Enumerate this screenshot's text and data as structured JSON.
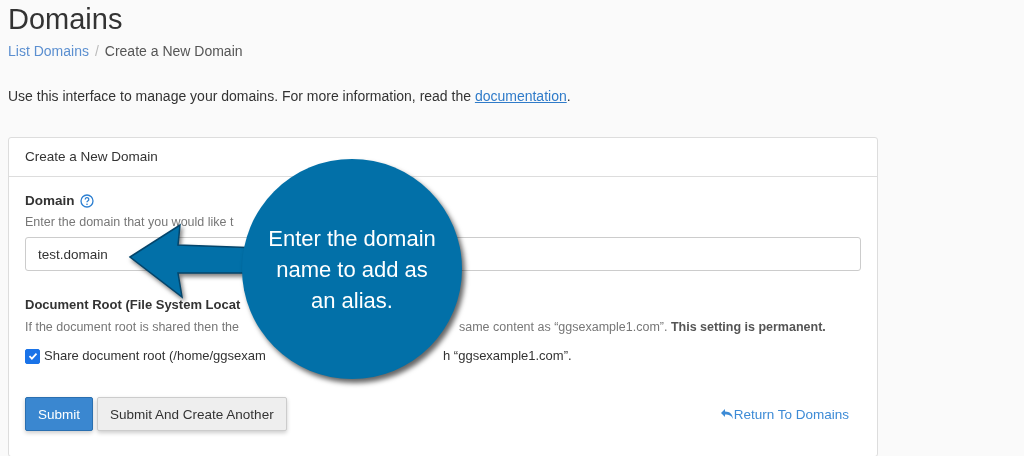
{
  "page_title": "Domains",
  "breadcrumb": [
    {
      "label": "List Domains",
      "kind": "link"
    },
    {
      "label": "/",
      "kind": "separator"
    },
    {
      "label": "Create a New Domain",
      "kind": "current"
    }
  ],
  "intro": {
    "text": "Use this interface to manage your domains. For more information, read the ",
    "link": "documentation",
    "end": "."
  },
  "panel": {
    "title": "Create a New Domain",
    "domain_field": {
      "label": "Domain",
      "help_visible": true,
      "hint": "Enter the domain that you would like t",
      "value": "test.domain"
    },
    "document_root": {
      "label": "Document Root (File System Locat",
      "description_start": "If the document root is shared then the",
      "description_end": "same content as “ggsexample1.com”. **This setting is permanent.**",
      "share": {
        "label_start": "Share document root (/home/ggsexam",
        "label_end": "h “ggsexample1.com”.",
        "checked": true
      }
    },
    "buttons": [
      {
        "label": "Submit",
        "kind": "primary"
      },
      {
        "label": "Submit And Create Another",
        "kind": "default"
      }
    ],
    "return_link": "Return To Domains"
  },
  "callout": {
    "text": "Enter the domain name to add as an alias."
  }
}
